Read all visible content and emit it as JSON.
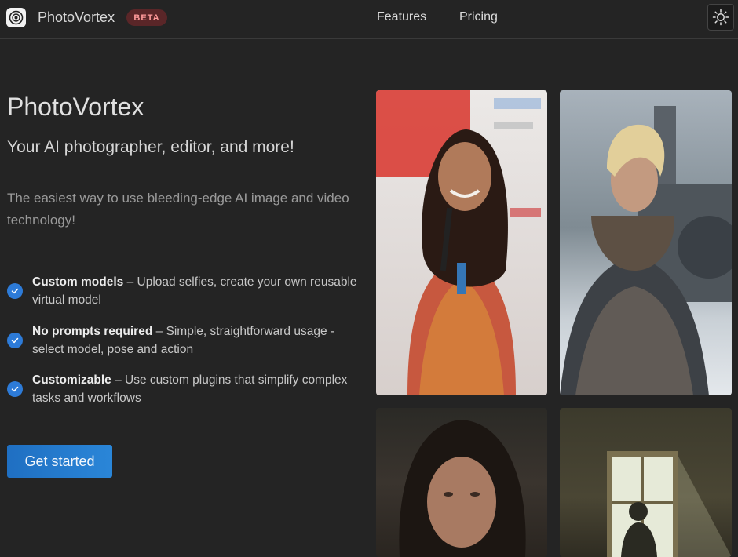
{
  "header": {
    "logo_icon": "aperture-icon",
    "brand": "PhotoVortex",
    "badge": "BETA",
    "nav": [
      {
        "label": "Features"
      },
      {
        "label": "Pricing"
      }
    ],
    "theme_icon": "sun-icon"
  },
  "hero": {
    "title": "PhotoVortex",
    "subtitle": "Your AI photographer, editor, and more!",
    "description": "The easiest way to use bleeding-edge AI image and video technology!",
    "features": [
      {
        "title": "Custom models",
        "text": " – Upload selfies, create your own reusable virtual model"
      },
      {
        "title": "No prompts required",
        "text": " – Simple, straightforward usage - select model, pose and action"
      },
      {
        "title": "Customizable",
        "text": " – Use custom plugins that simplify complex tasks and workflows"
      }
    ],
    "cta_label": "Get started"
  },
  "gallery": [
    {
      "name": "speaker-photo"
    },
    {
      "name": "armored-warrior-photo"
    },
    {
      "name": "portrait-photo"
    },
    {
      "name": "window-silhouette-photo"
    }
  ],
  "colors": {
    "background": "#242424",
    "accent": "#2a86d8",
    "badge_bg": "#5a2628",
    "badge_text": "#ff9b9b"
  }
}
